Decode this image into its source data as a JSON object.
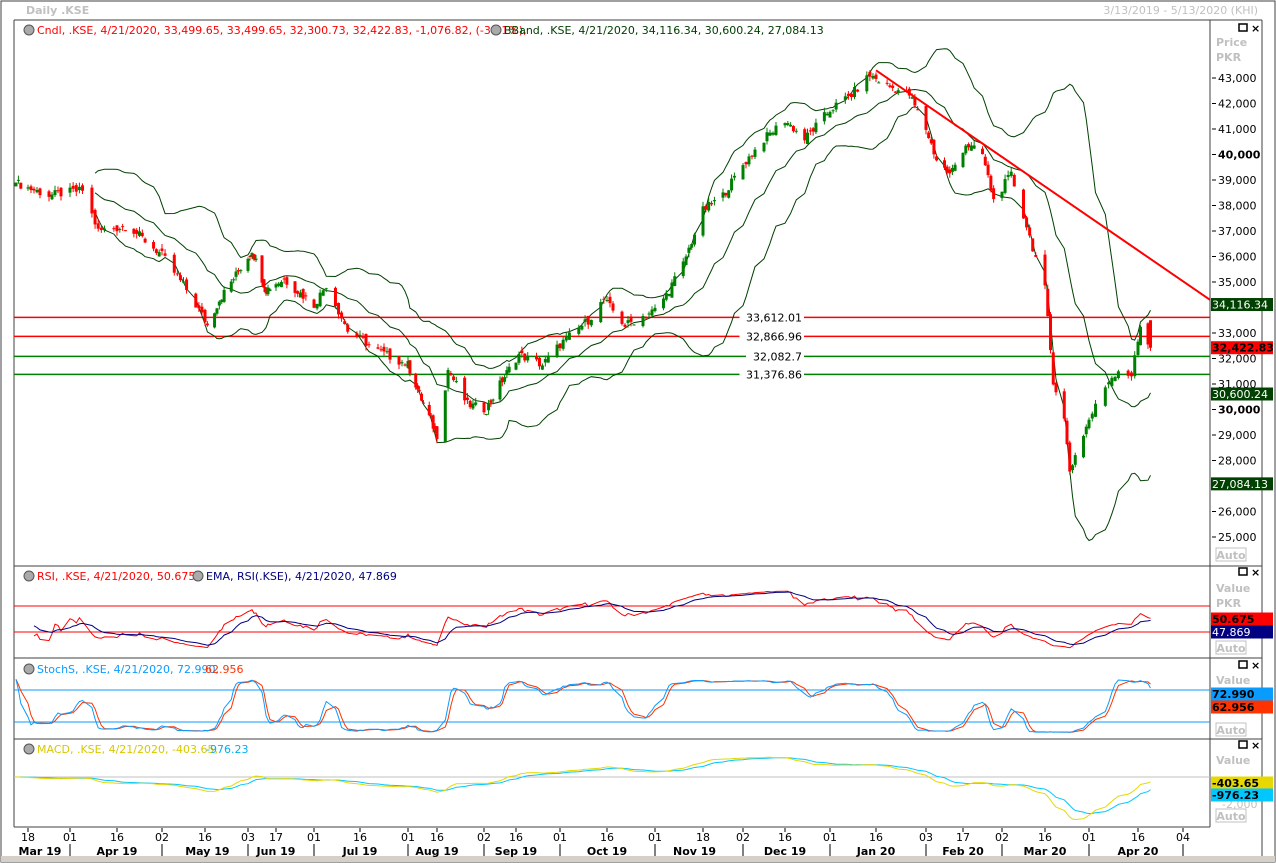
{
  "header": {
    "title": "Daily .KSE",
    "range": "3/13/2019 - 5/13/2020 (KHI)"
  },
  "legend": {
    "candle": "Cndl, .KSE, 4/21/2020, 33,499.65, 33,499.65, 32,300.73, 32,422.83, -1,076.82, (-3.21%),",
    "bband": "BBand, .KSE, 4/21/2020, 34,116.34, 30,600.24, 27,084.13",
    "rsi": "RSI, .KSE, 4/21/2020, 50.675,",
    "ema": "EMA, RSI(.KSE), 4/21/2020, 47.869",
    "stoch": "StochS, .KSE, 4/21/2020, 72.990,",
    "stoch_d": "62.956",
    "macd": "MACD, .KSE, 4/21/2020, -403.65,",
    "macd_signal": "-976.23"
  },
  "axis": {
    "price_label": "Price",
    "value_label": "Value",
    "currency": "PKR",
    "auto": "Auto",
    "macd_tick": "-2,000",
    "price_ticks": [
      "43,000",
      "42,000",
      "41,000",
      "40,000",
      "39,000",
      "38,000",
      "37,000",
      "36,000",
      "35,000",
      "33,000",
      "32,000",
      "31,000",
      "30,000",
      "29,000",
      "28,000",
      "26,000",
      "25,000"
    ],
    "price_tick_values": [
      43000,
      42000,
      41000,
      40000,
      39000,
      38000,
      37000,
      36000,
      35000,
      33000,
      32000,
      31000,
      30000,
      29000,
      28000,
      26000,
      25000
    ],
    "date_ticks": [
      {
        "d": "2019-03-18",
        "t": "18"
      },
      {
        "d": "2019-04-01",
        "t": "01"
      },
      {
        "d": "2019-04-16",
        "t": "16"
      },
      {
        "d": "2019-05-02",
        "t": "02"
      },
      {
        "d": "2019-05-16",
        "t": "16"
      },
      {
        "d": "2019-06-03",
        "t": "03"
      },
      {
        "d": "2019-06-17",
        "t": "17"
      },
      {
        "d": "2019-07-01",
        "t": "01"
      },
      {
        "d": "2019-07-16",
        "t": "16"
      },
      {
        "d": "2019-08-01",
        "t": "01"
      },
      {
        "d": "2019-08-16",
        "t": "16"
      },
      {
        "d": "2019-09-02",
        "t": "02"
      },
      {
        "d": "2019-09-16",
        "t": "16"
      },
      {
        "d": "2019-10-01",
        "t": "01"
      },
      {
        "d": "2019-10-16",
        "t": "16"
      },
      {
        "d": "2019-11-01",
        "t": "01"
      },
      {
        "d": "2019-11-18",
        "t": "18"
      },
      {
        "d": "2019-12-02",
        "t": "02"
      },
      {
        "d": "2019-12-16",
        "t": "16"
      },
      {
        "d": "2020-01-01",
        "t": "01"
      },
      {
        "d": "2020-01-16",
        "t": "16"
      },
      {
        "d": "2020-02-03",
        "t": "03"
      },
      {
        "d": "2020-02-17",
        "t": "17"
      },
      {
        "d": "2020-03-02",
        "t": "02"
      },
      {
        "d": "2020-03-16",
        "t": "16"
      },
      {
        "d": "2020-04-01",
        "t": "01"
      },
      {
        "d": "2020-04-16",
        "t": "16"
      },
      {
        "d": "2020-05-04",
        "t": "04"
      }
    ],
    "months": [
      {
        "d": "2019-03-22",
        "t": "Mar 19"
      },
      {
        "d": "2019-04-16",
        "t": "Apr 19"
      },
      {
        "d": "2019-05-17",
        "t": "May 19"
      },
      {
        "d": "2019-06-17",
        "t": "Jun 19"
      },
      {
        "d": "2019-07-16",
        "t": "Jul 19"
      },
      {
        "d": "2019-08-16",
        "t": "Aug 19"
      },
      {
        "d": "2019-09-16",
        "t": "Sep 19"
      },
      {
        "d": "2019-10-16",
        "t": "Oct 19"
      },
      {
        "d": "2019-11-15",
        "t": "Nov 19"
      },
      {
        "d": "2019-12-16",
        "t": "Dec 19"
      },
      {
        "d": "2020-01-16",
        "t": "Jan 20"
      },
      {
        "d": "2020-02-17",
        "t": "Feb 20"
      },
      {
        "d": "2020-03-16",
        "t": "Mar 20"
      },
      {
        "d": "2020-04-16",
        "t": "Apr 20"
      }
    ]
  },
  "tags": {
    "bb_upper": "34,116.34",
    "close": "32,422.83",
    "bb_mid": "30,600.24",
    "bb_lower": "27,084.13",
    "rsi": "50.675",
    "rsi_ema": "47.869",
    "stoch_k": "72.990",
    "stoch_d": "62.956",
    "macd": "-403.65",
    "macd_signal": "-976.23"
  },
  "colors": {
    "up": "#008000",
    "down": "#ff0000",
    "band": "#004000",
    "rsi": "#ff0000",
    "ema": "#000080",
    "stoch_k": "#0a9bff",
    "stoch_d": "#ff3300",
    "macd": "#e6d800",
    "signal": "#00c8ff"
  },
  "chart_data": {
    "type": "candlestick",
    "title": "Daily .KSE",
    "ylabel": "Price PKR",
    "ylim": [
      24500,
      44000
    ],
    "last_candle": {
      "date": "2020-04-21",
      "open": 33499.65,
      "high": 33499.65,
      "low": 32300.73,
      "close": 32422.83,
      "change": -1076.82,
      "change_pct": -3.21
    },
    "bollinger": {
      "upper": 34116.34,
      "middle": 30600.24,
      "lower": 27084.13
    },
    "horizontal_lines": [
      {
        "value": 33612.01,
        "label": "33,612.01",
        "color": "red"
      },
      {
        "value": 32866.96,
        "label": "32,866.96",
        "color": "red"
      },
      {
        "value": 32082.7,
        "label": "32,082.7",
        "color": "green"
      },
      {
        "value": 31376.86,
        "label": "31,376.86",
        "color": "green"
      }
    ],
    "trendline": {
      "start": {
        "date": "2020-01-16",
        "value": 43300
      },
      "end": {
        "date": "2020-05-08",
        "value": 34300
      }
    },
    "closes": [
      [
        "2019-03-13",
        38900
      ],
      [
        "2019-03-25",
        38400
      ],
      [
        "2019-04-05",
        38600
      ],
      [
        "2019-04-10",
        37000
      ],
      [
        "2019-04-20",
        37200
      ],
      [
        "2019-05-02",
        36050
      ],
      [
        "2019-05-10",
        34700
      ],
      [
        "2019-05-17",
        33300
      ],
      [
        "2019-05-22",
        34300
      ],
      [
        "2019-06-01",
        35700
      ],
      [
        "2019-06-05",
        36250
      ],
      [
        "2019-06-12",
        34700
      ],
      [
        "2019-06-20",
        35100
      ],
      [
        "2019-07-01",
        34100
      ],
      [
        "2019-07-05",
        34900
      ],
      [
        "2019-07-12",
        33100
      ],
      [
        "2019-07-22",
        32300
      ],
      [
        "2019-08-01",
        31750
      ],
      [
        "2019-08-08",
        30400
      ],
      [
        "2019-08-16",
        29000
      ],
      [
        "2019-08-20",
        31550
      ],
      [
        "2019-08-27",
        30200
      ],
      [
        "2019-09-03",
        30000
      ],
      [
        "2019-09-10",
        31150
      ],
      [
        "2019-09-17",
        32150
      ],
      [
        "2019-09-25",
        31750
      ],
      [
        "2019-10-01",
        32550
      ],
      [
        "2019-10-10",
        33500
      ],
      [
        "2019-10-15",
        34300
      ],
      [
        "2019-10-22",
        33300
      ],
      [
        "2019-11-01",
        33900
      ],
      [
        "2019-11-05",
        34500
      ],
      [
        "2019-11-11",
        35700
      ],
      [
        "2019-11-18",
        37800
      ],
      [
        "2019-11-25",
        38400
      ],
      [
        "2019-12-02",
        39600
      ],
      [
        "2019-12-09",
        40600
      ],
      [
        "2019-12-16",
        41350
      ],
      [
        "2019-12-23",
        40600
      ],
      [
        "2020-01-01",
        41750
      ],
      [
        "2020-01-08",
        42350
      ],
      [
        "2020-01-14",
        43100
      ],
      [
        "2020-01-20",
        42700
      ],
      [
        "2020-01-28",
        42350
      ],
      [
        "2020-02-03",
        41000
      ],
      [
        "2020-02-07",
        39800
      ],
      [
        "2020-02-12",
        39200
      ],
      [
        "2020-02-18",
        40400
      ],
      [
        "2020-02-24",
        40000
      ],
      [
        "2020-02-28",
        38200
      ],
      [
        "2020-03-05",
        39200
      ],
      [
        "2020-03-10",
        37200
      ],
      [
        "2020-03-16",
        34700
      ],
      [
        "2020-03-19",
        31150
      ],
      [
        "2020-03-23",
        29600
      ],
      [
        "2020-03-25",
        27600
      ],
      [
        "2020-03-27",
        28200
      ],
      [
        "2020-04-01",
        29600
      ],
      [
        "2020-04-07",
        31150
      ],
      [
        "2020-04-10",
        31550
      ],
      [
        "2020-04-14",
        31350
      ],
      [
        "2020-04-17",
        33300
      ],
      [
        "2020-04-21",
        32422.83
      ]
    ],
    "indicators": {
      "rsi": {
        "value": 50.675,
        "ema": 47.869,
        "levels": [
          70,
          30
        ]
      },
      "stoch": {
        "k": 72.99,
        "d": 62.956,
        "levels": [
          80,
          20
        ]
      },
      "macd": {
        "macd": -403.65,
        "signal": -976.23
      }
    }
  }
}
